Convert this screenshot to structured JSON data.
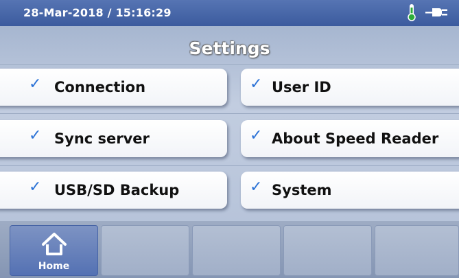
{
  "status": {
    "datetime": "28-Mar-2018 / 15:16:29",
    "thermometer_icon": "thermometer-icon",
    "thermometer_color": "#2eae3a",
    "plug_icon": "plug-icon"
  },
  "page_title": "Settings",
  "menu": {
    "connection": "Connection",
    "user_id": "User ID",
    "sync_server": "Sync server",
    "about": "About Speed Reader",
    "usb_backup": "USB/SD Backup",
    "system": "System",
    "check_icon": "check-icon",
    "check_color": "#2b72d6",
    "check_glyph": "✓"
  },
  "bottom_nav": {
    "home_label": "Home",
    "home_icon": "home-icon"
  }
}
